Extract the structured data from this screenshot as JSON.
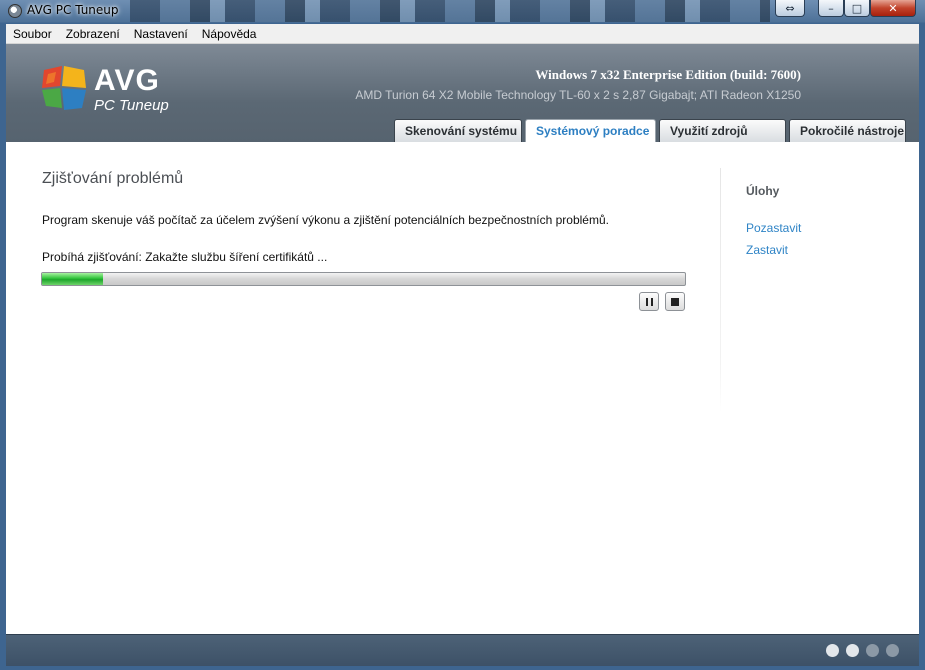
{
  "window": {
    "title": "AVG PC Tuneup"
  },
  "menu": [
    "Soubor",
    "Zobrazení",
    "Nastavení",
    "Nápověda"
  ],
  "header": {
    "logo_text": "AVG",
    "logo_sub": "PC Tuneup",
    "os_info": "Windows 7 x32 Enterprise Edition (build: 7600)",
    "hw_info": "AMD Turion 64 X2 Mobile Technology TL-60 x 2 s 2,87 Gigabajt; ATI Radeon X1250"
  },
  "tabs": [
    {
      "label": "Skenování systému",
      "active": false
    },
    {
      "label": "Systémový poradce",
      "active": true
    },
    {
      "label": "Využití zdrojů",
      "active": false
    },
    {
      "label": "Pokročilé nástroje",
      "active": false
    }
  ],
  "main": {
    "heading": "Zjišťování problémů",
    "description": "Program skenuje váš počítač za účelem zvýšení výkonu a zjištění potenciálních bezpečnostních problémů.",
    "status": "Probíhá zjišťování: Zakažte službu šíření certifikátů ...",
    "progress_fraction": 0.095
  },
  "sidebar": {
    "title": "Úlohy",
    "links": [
      "Pozastavit",
      "Zastavit"
    ]
  },
  "footer": {
    "page_dots": 4,
    "active_dots": 2
  },
  "colors": {
    "accent": "#2d7fc2",
    "progress": "#2fc33a",
    "header_bg": "#5b6874"
  },
  "icons": {
    "pause": "pause-icon",
    "stop": "stop-icon",
    "app": "app-icon"
  }
}
